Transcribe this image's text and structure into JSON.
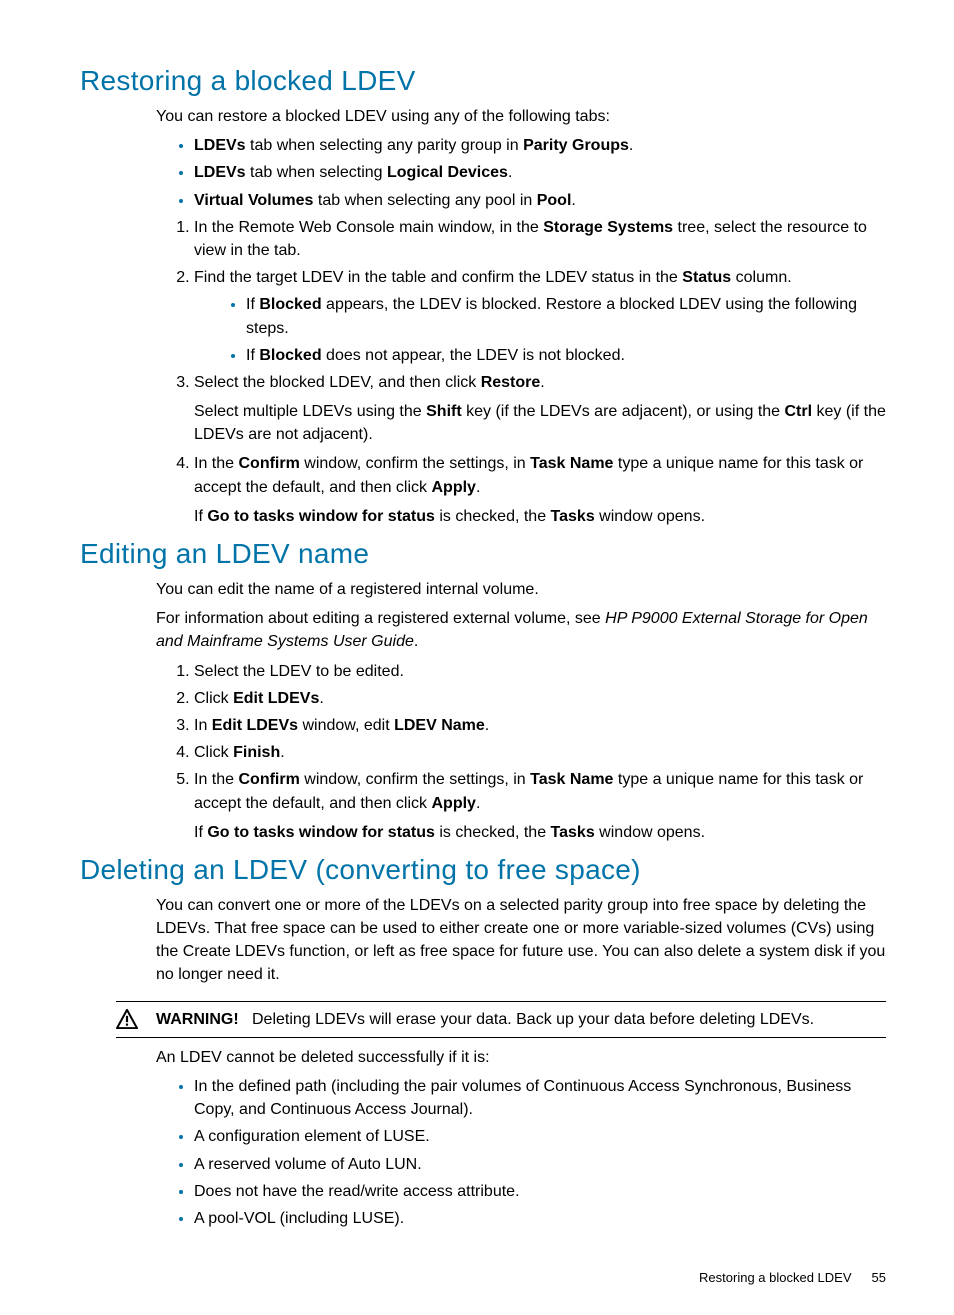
{
  "section1": {
    "heading": "Restoring a blocked LDEV",
    "intro": "You can restore a blocked LDEV using any of the following tabs:",
    "bullets": [
      {
        "b1": "LDEVs",
        "t1": " tab when selecting any parity group in ",
        "b2": "Parity Groups",
        "t2": "."
      },
      {
        "b1": "LDEVs",
        "t1": " tab when selecting ",
        "b2": "Logical Devices",
        "t2": "."
      },
      {
        "b1": "Virtual Volumes",
        "t1": " tab when selecting any pool in ",
        "b2": "Pool",
        "t2": "."
      }
    ],
    "steps": {
      "s1": {
        "t1": "In the Remote Web Console main window, in the ",
        "b1": "Storage Systems",
        "t2": " tree, select the resource to view in the tab."
      },
      "s2": {
        "t1": "Find the target LDEV in the table and confirm the LDEV status in the ",
        "b1": "Status",
        "t2": " column."
      },
      "s2sub": [
        {
          "t1": "If ",
          "b1": "Blocked",
          "t2": " appears, the LDEV is blocked. Restore a blocked LDEV using the following steps."
        },
        {
          "t1": "If ",
          "b1": "Blocked",
          "t2": " does not appear, the LDEV is not blocked."
        }
      ],
      "s3": {
        "t1": "Select the blocked LDEV, and then click ",
        "b1": "Restore",
        "t2": "."
      },
      "s3p": {
        "t1": "Select multiple LDEVs using the ",
        "b1": "Shift",
        "t2": " key (if the LDEVs are adjacent), or using the ",
        "b2": "Ctrl",
        "t3": " key (if the LDEVs are not adjacent)."
      },
      "s4": {
        "t1": "In the ",
        "b1": "Confirm",
        "t2": " window, confirm the settings, in ",
        "b2": "Task Name",
        "t3": " type a unique name for this task or accept the default, and then click ",
        "b3": "Apply",
        "t4": "."
      },
      "s4p": {
        "t1": "If ",
        "b1": "Go to tasks window for status",
        "t2": " is checked, the ",
        "b2": "Tasks",
        "t3": " window opens."
      }
    }
  },
  "section2": {
    "heading": "Editing an LDEV name",
    "intro": "You can edit the name of a registered internal volume.",
    "ref": {
      "t1": "For information about editing a registered external volume, see ",
      "i1": "HP P9000 External Storage for Open and Mainframe Systems User Guide",
      "t2": "."
    },
    "steps": {
      "s1": "Select the LDEV to be edited.",
      "s2": {
        "t1": "Click ",
        "b1": "Edit LDEVs",
        "t2": "."
      },
      "s3": {
        "t1": "In ",
        "b1": "Edit LDEVs",
        "t2": " window, edit ",
        "b2": "LDEV Name",
        "t3": "."
      },
      "s4": {
        "t1": "Click ",
        "b1": "Finish",
        "t2": "."
      },
      "s5": {
        "t1": "In the ",
        "b1": "Confirm",
        "t2": " window, confirm the settings, in ",
        "b2": "Task Name",
        "t3": " type a unique name for this task or accept the default, and then click ",
        "b3": "Apply",
        "t4": "."
      },
      "s5p": {
        "t1": "If ",
        "b1": "Go to tasks window for status",
        "t2": " is checked, the ",
        "b2": "Tasks",
        "t3": " window opens."
      }
    }
  },
  "section3": {
    "heading": "Deleting an LDEV (converting to free space)",
    "intro": "You can convert one or more of the LDEVs on a selected parity group into free space by deleting the LDEVs. That free space can be used to either create one or more variable-sized volumes (CVs) using the Create LDEVs function, or left as free space for future use. You can also delete a system disk if you no longer need it.",
    "warning_label": "WARNING!",
    "warning_text": "Deleting LDEVs will erase your data. Back up your data before deleting LDEVs.",
    "post": "An LDEV cannot be deleted successfully if it is:",
    "bullets": [
      "In the defined path (including the pair volumes of Continuous Access Synchronous, Business Copy, and Continuous Access Journal).",
      "A configuration element of LUSE.",
      "A reserved volume of Auto LUN.",
      "Does not have the read/write access attribute.",
      "A pool-VOL (including LUSE)."
    ]
  },
  "footer": {
    "text": "Restoring a blocked LDEV",
    "page": "55"
  }
}
